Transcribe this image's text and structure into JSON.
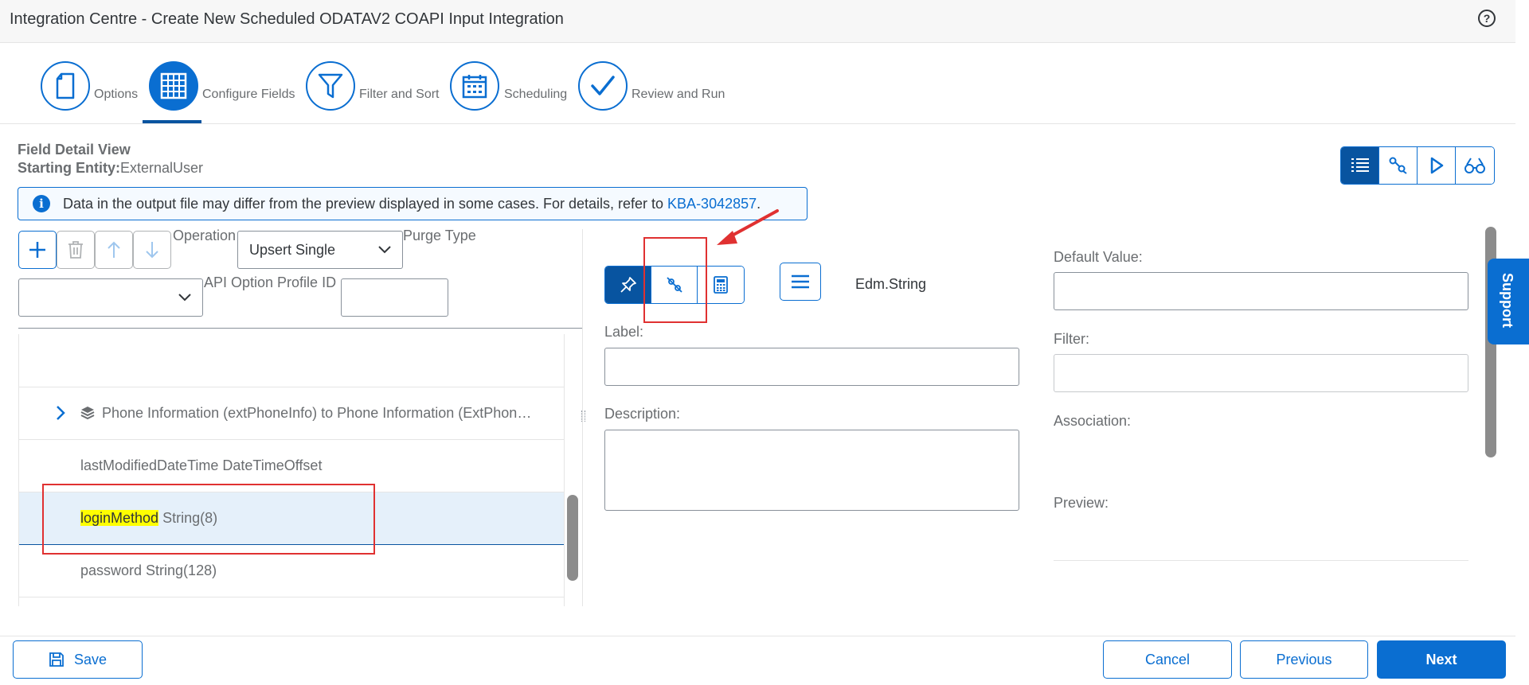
{
  "window": {
    "title": "Integration Centre - Create New Scheduled ODATAV2 COAPI Input Integration",
    "help_icon": "?"
  },
  "wizard": {
    "steps": [
      {
        "label": "Options",
        "icon": "document-icon",
        "active": false
      },
      {
        "label": "Configure Fields",
        "icon": "grid-icon",
        "active": true
      },
      {
        "label": "Filter and Sort",
        "icon": "filter-icon",
        "active": false
      },
      {
        "label": "Scheduling",
        "icon": "calendar-icon",
        "active": false
      },
      {
        "label": "Review and Run",
        "icon": "checkmark-icon",
        "active": false
      }
    ]
  },
  "field_detail": {
    "title": "Field Detail View",
    "starting_entity_label": "Starting Entity:",
    "starting_entity_value": "ExternalUser"
  },
  "info_strip": {
    "text": "Data in the output file may differ from the preview displayed in some cases. For details, refer to ",
    "link": "KBA-3042857",
    "suffix": "."
  },
  "toolbar": {
    "operation_label": "Operation",
    "operation_value": "Upsert Single",
    "purge_type_label": "Purge Type",
    "purge_type_value": "",
    "api_option_label": "API Option Profile ID",
    "api_option_value": ""
  },
  "tree": {
    "rows": [
      {
        "text": "Phone Information (extPhoneInfo) to Phone Information (ExtPhon…"
      },
      {
        "text": "lastModifiedDateTime DateTimeOffset"
      },
      {
        "name": "loginMethod",
        "type": " String(8)"
      },
      {
        "text": "password String(128)"
      }
    ]
  },
  "detail": {
    "data_type": "Edm.String",
    "label_label": "Label:",
    "label_value": "",
    "description_label": "Description:",
    "description_value": "",
    "default_value_label": "Default Value:",
    "default_value_value": "",
    "filter_label": "Filter:",
    "filter_value": "",
    "association_label": "Association:",
    "preview_label": "Preview:"
  },
  "side": {
    "support_label": "Support"
  },
  "footer": {
    "save": "Save",
    "cancel": "Cancel",
    "previous": "Previous",
    "next": "Next"
  },
  "colors": {
    "accent": "#0a6ed1",
    "accent_dark": "#0854a0",
    "highlight": "#ffff00",
    "annotation": "#e03131"
  }
}
